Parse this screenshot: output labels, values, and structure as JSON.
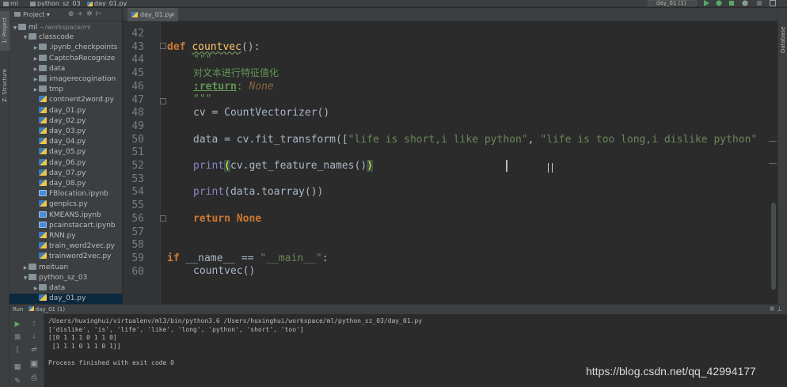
{
  "nav": {
    "project": "ml",
    "folder": "python_sz_03",
    "file": "day_01.py"
  },
  "run_config": "day_01 (1)",
  "left_strip": {
    "project_tab": "1: Project",
    "structure_tab": "Z: Structure"
  },
  "right_strip": {
    "database_tab": "Database"
  },
  "project_panel": {
    "title": "Project",
    "tree": [
      {
        "label": "ml",
        "suffix": "~/workspace/ml",
        "depth": 0,
        "type": "folder",
        "expanded": true
      },
      {
        "label": "classcode",
        "depth": 1,
        "type": "folder",
        "expanded": true
      },
      {
        "label": ".ipynb_checkpoints",
        "depth": 2,
        "type": "folder",
        "expanded": false
      },
      {
        "label": "CaptchaRecognize",
        "depth": 2,
        "type": "folder",
        "expanded": false
      },
      {
        "label": "data",
        "depth": 2,
        "type": "folder",
        "expanded": false
      },
      {
        "label": "imagerecogination",
        "depth": 2,
        "type": "folder",
        "expanded": false
      },
      {
        "label": "tmp",
        "depth": 2,
        "type": "folder",
        "expanded": false
      },
      {
        "label": "contnent2word.py",
        "depth": 2,
        "type": "py"
      },
      {
        "label": "day_01.py",
        "depth": 2,
        "type": "py"
      },
      {
        "label": "day_02.py",
        "depth": 2,
        "type": "py"
      },
      {
        "label": "day_03.py",
        "depth": 2,
        "type": "py"
      },
      {
        "label": "day_04.py",
        "depth": 2,
        "type": "py"
      },
      {
        "label": "day_05.py",
        "depth": 2,
        "type": "py"
      },
      {
        "label": "day_06.py",
        "depth": 2,
        "type": "py"
      },
      {
        "label": "day_07.py",
        "depth": 2,
        "type": "py"
      },
      {
        "label": "day_08.py",
        "depth": 2,
        "type": "py"
      },
      {
        "label": "FBlocation.ipynb",
        "depth": 2,
        "type": "nb"
      },
      {
        "label": "genpics.py",
        "depth": 2,
        "type": "py"
      },
      {
        "label": "KMEANS.ipynb",
        "depth": 2,
        "type": "nb"
      },
      {
        "label": "pcainstacart.ipynb",
        "depth": 2,
        "type": "nb"
      },
      {
        "label": "RNN.py",
        "depth": 2,
        "type": "py"
      },
      {
        "label": "train_word2vec.py",
        "depth": 2,
        "type": "py"
      },
      {
        "label": "trainword2vec.py",
        "depth": 2,
        "type": "py"
      },
      {
        "label": "meituan",
        "depth": 1,
        "type": "folder",
        "expanded": false
      },
      {
        "label": "python_sz_03",
        "depth": 1,
        "type": "folder",
        "expanded": true
      },
      {
        "label": "data",
        "depth": 2,
        "type": "folder",
        "expanded": false
      },
      {
        "label": "day_01.py",
        "depth": 2,
        "type": "py",
        "selected": true
      }
    ]
  },
  "editor": {
    "tab_label": "day_01.py",
    "line_numbers": [
      "42",
      "43",
      "44",
      "45",
      "46",
      "47",
      "48",
      "49",
      "50",
      "51",
      "52",
      "53",
      "54",
      "55",
      "56",
      "57",
      "58",
      "59",
      "60"
    ],
    "code": {
      "l43_def": "def",
      "l43_name": "countvec",
      "l43_rest": "():",
      "l44": "\"\"\"",
      "l45": "对文本进行特征值化",
      "l46_tag": ":return",
      "l46_colon": ":",
      "l46_type": " None",
      "l47": "\"\"\"",
      "l48": "cv = CountVectorizer()",
      "l50_a": "data = cv.fit_transform([",
      "l50_s1": "\"life is short,i like python\"",
      "l50_sep": ", ",
      "l50_s2": "\"life is too long,i dislike python\"",
      "l52_print": "print",
      "l52_open": "(",
      "l52_mid": "cv.get_feature_names()",
      "l52_close": ")",
      "l54_print": "print",
      "l54_rest": "(data.toarray())",
      "l56_return": "return",
      "l56_none": "None",
      "l59_if": "if",
      "l59_mid": " __name__ == ",
      "l59_str": "\"__main__\"",
      "l59_colon": ":",
      "l60": "countvec()"
    }
  },
  "run_panel": {
    "header": "Run",
    "config": "day_01 (1)",
    "output": [
      "/Users/huxinghui/virtualenv/ml3/bin/python3.6 /Users/huxinghui/workspace/ml/python_sz_03/day_01.py",
      "['dislike', 'is', 'life', 'like', 'long', 'python', 'short', 'too']",
      "[[0 1 1 1 0 1 1 0]",
      " [1 1 1 0 1 1 0 1]]",
      "",
      "Process finished with exit code 0"
    ]
  },
  "watermark": "https://blog.csdn.net/qq_42994177",
  "colors": {
    "editor_bg": "#2b2b2b",
    "panel_bg": "#3c3f41",
    "keyword": "#cc7832",
    "function": "#ffc66d",
    "string": "#6a8759",
    "docstring": "#629755",
    "builtin": "#8888c6"
  }
}
